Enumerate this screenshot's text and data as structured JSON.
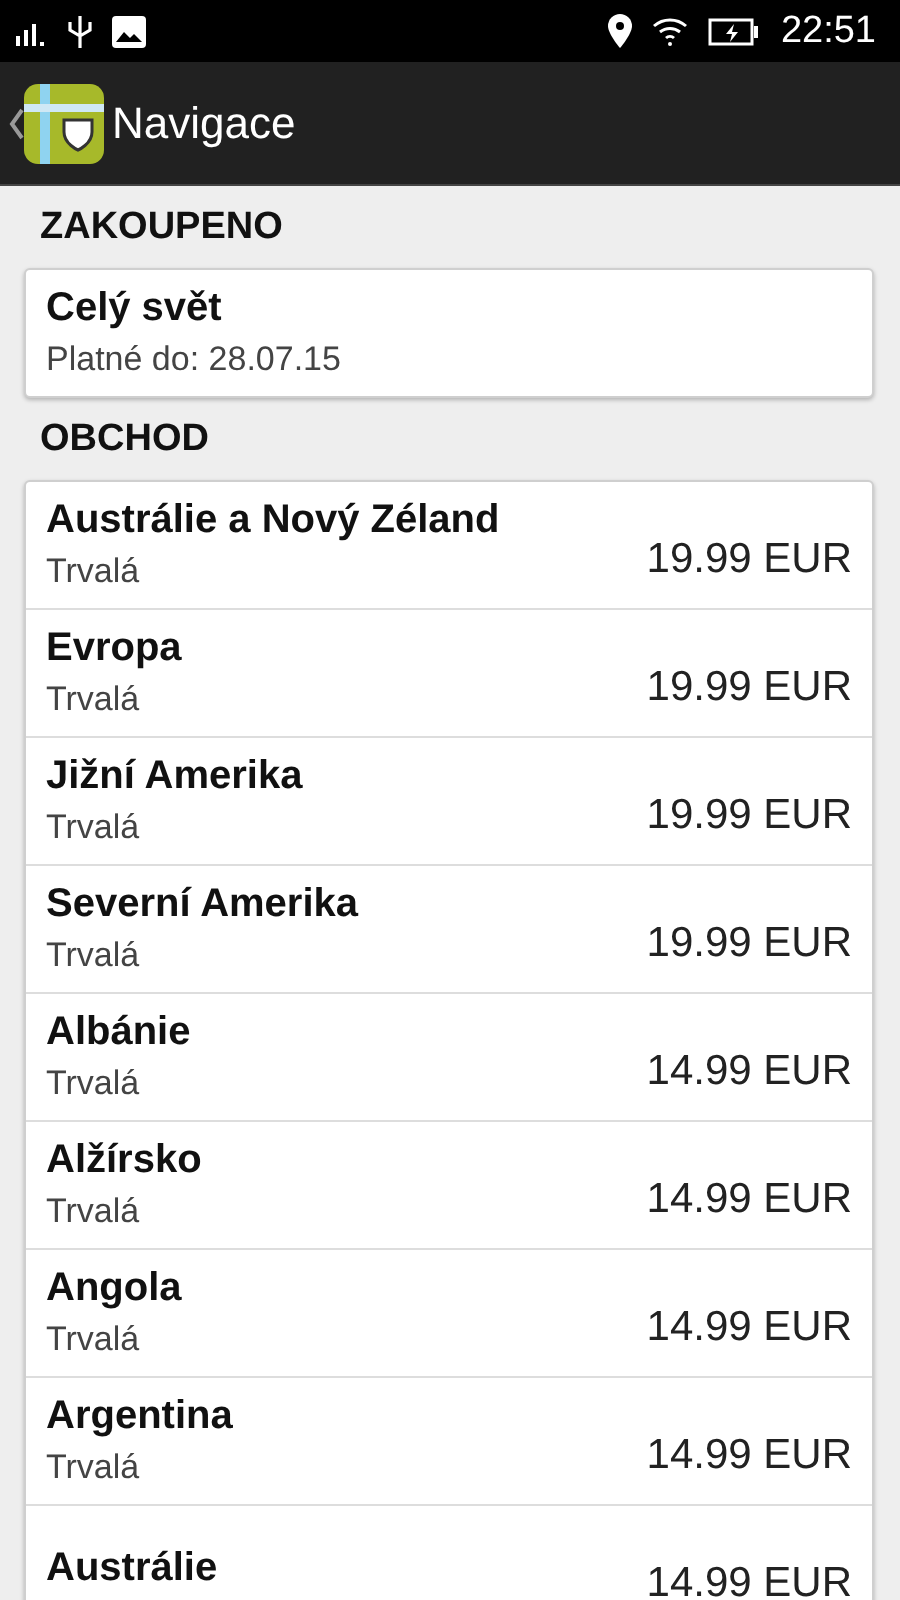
{
  "status_bar": {
    "time": "22:51"
  },
  "app_bar": {
    "title": "Navigace"
  },
  "sections": [
    {
      "title": "ZAKOUPENO",
      "items": [
        {
          "name": "Celý svět",
          "subtitle": "Platné do: 28.07.15"
        }
      ]
    },
    {
      "title": "OBCHOD",
      "items": [
        {
          "name": "Austrálie a Nový Zéland",
          "subtitle": "Trvalá",
          "price": "19.99 EUR"
        },
        {
          "name": "Evropa",
          "subtitle": "Trvalá",
          "price": "19.99 EUR"
        },
        {
          "name": "Jižní Amerika",
          "subtitle": "Trvalá",
          "price": "19.99 EUR"
        },
        {
          "name": "Severní Amerika",
          "subtitle": "Trvalá",
          "price": "19.99 EUR"
        },
        {
          "name": "Albánie",
          "subtitle": "Trvalá",
          "price": "14.99 EUR"
        },
        {
          "name": "Alžírsko",
          "subtitle": "Trvalá",
          "price": "14.99 EUR"
        },
        {
          "name": "Angola",
          "subtitle": "Trvalá",
          "price": "14.99 EUR"
        },
        {
          "name": "Argentina",
          "subtitle": "Trvalá",
          "price": "14.99 EUR"
        },
        {
          "name": "Austrálie",
          "price": "14.99 EUR"
        }
      ]
    }
  ]
}
